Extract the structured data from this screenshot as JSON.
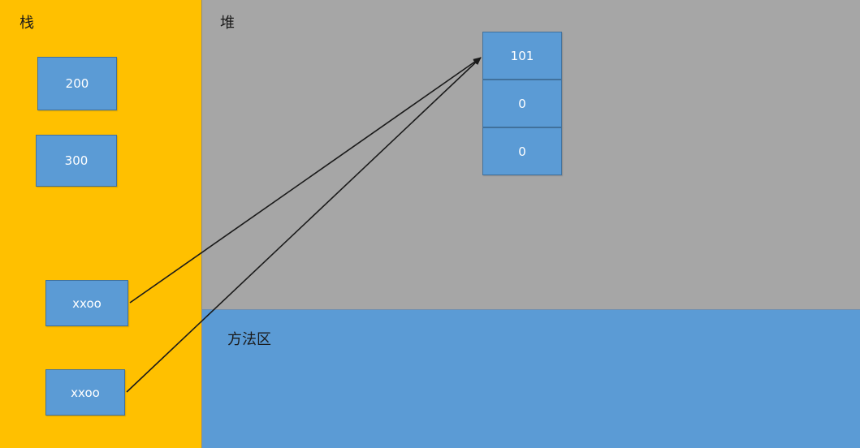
{
  "regions": {
    "stack_label": "栈",
    "heap_label": "堆",
    "method_area_label": "方法区"
  },
  "stack": {
    "values": [
      "200",
      "300",
      "xxoo",
      "xxoo"
    ]
  },
  "heap": {
    "array_values": [
      "101",
      "0",
      "0"
    ]
  },
  "colors": {
    "stack": "#ffc000",
    "heap": "#a6a6a6",
    "method_area": "#5b9bd5",
    "box_fill": "#5b9bd5",
    "arrow": "#1a1a1a"
  }
}
